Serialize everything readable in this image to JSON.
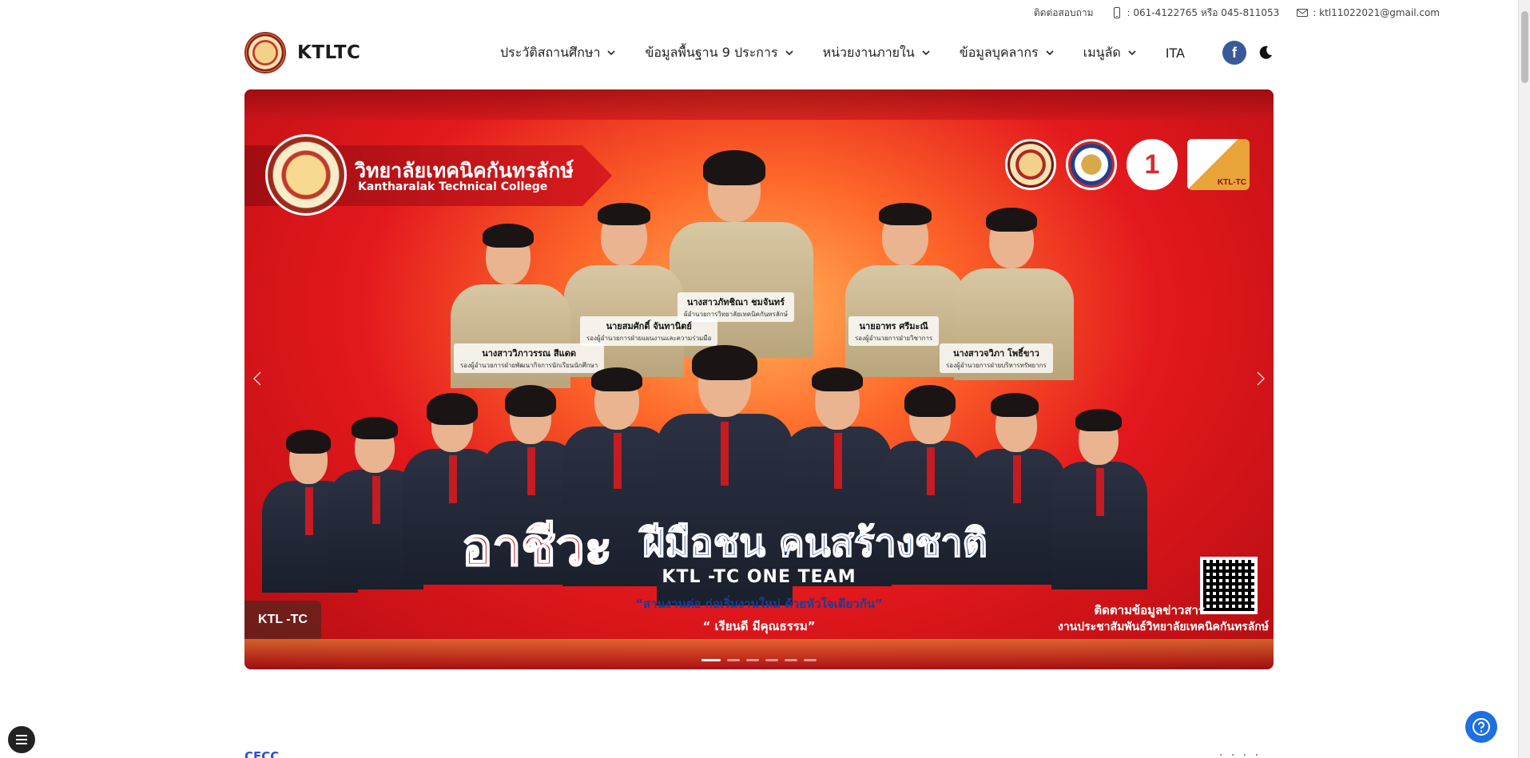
{
  "topbar": {
    "contact_label": "ติดต่อสอบถาม",
    "phone": ": 061-4122765 หรือ 045-811053",
    "email": ": ktl11022021@gmail.com"
  },
  "header": {
    "brand": "KTLTC",
    "nav": [
      {
        "label": "ประวัติสถานศึกษา",
        "icon": "chevron-down-icon"
      },
      {
        "label": "ข้อมูลพื้นฐาน 9 ประการ",
        "icon": "chevron-down-icon"
      },
      {
        "label": "หน่วยงานภายใน",
        "icon": "chevron-down-icon"
      },
      {
        "label": "ข้อมูลบุคลากร",
        "icon": "chevron-down-icon"
      },
      {
        "label": "เมนูลัด",
        "icon": "chevron-down-icon"
      },
      {
        "label": "ITA"
      }
    ],
    "facebook_icon": "f"
  },
  "hero": {
    "college_th": "วิทยาลัยเทคนิคกันทรลักษ์",
    "college_en": "Kantharalak Technical College",
    "staff": [
      {
        "name": "นางสาวภัทชิณา ชมจันทร์",
        "title": "ผู้อำนวยการวิทยาลัยเทคนิคกันทรลักษ์"
      },
      {
        "name": "นายสมศักดิ์ จันทานิตย์",
        "title": "รองผู้อำนวยการฝ่ายแผนงานและความร่วมมือ"
      },
      {
        "name": "นายอาทร ศรีมะณี",
        "title": "รองผู้อำนวยการฝ่ายวิชาการ"
      },
      {
        "name": "นางสาววิภาวรรณ สีแดด",
        "title": "รองผู้อำนวยการฝ่ายพัฒนากิจการนักเรียนนักศึกษา"
      },
      {
        "name": "นางสาวจวิภา โพธิ์ขาว",
        "title": "รองผู้อำนวยการฝ่ายบริหารทรัพยากร"
      }
    ],
    "slogan_red": "อาชีวะ",
    "slogan_blue": "ฝีมือชน คนสร้างชาติ",
    "team": "KTL -TC ONE TEAM",
    "quote1": "“สานงานต่อ ก่อเริ่มงานใหม่ ด้วยหัวใจเดียวกัน”",
    "quote2": "“ เรียนดี มีคุณธรรม”",
    "follow1": "ติดตามข้อมูลข่าวสาร",
    "follow2": "งานประชาสัมพันธ์วิทยาลัยเทคนิคกันทรลักษ์",
    "badge": "KTL -TC",
    "partner_badge": "KTL-TC",
    "partner_one": "1",
    "slides": 6,
    "active_slide": 1
  },
  "section": {
    "title": "CECC",
    "more": "· · · ·"
  },
  "colors": {
    "accent": "#2a4fd0",
    "hero_red": "#e3181d",
    "help_button": "#1e6fe0",
    "facebook": "#3b5998"
  }
}
